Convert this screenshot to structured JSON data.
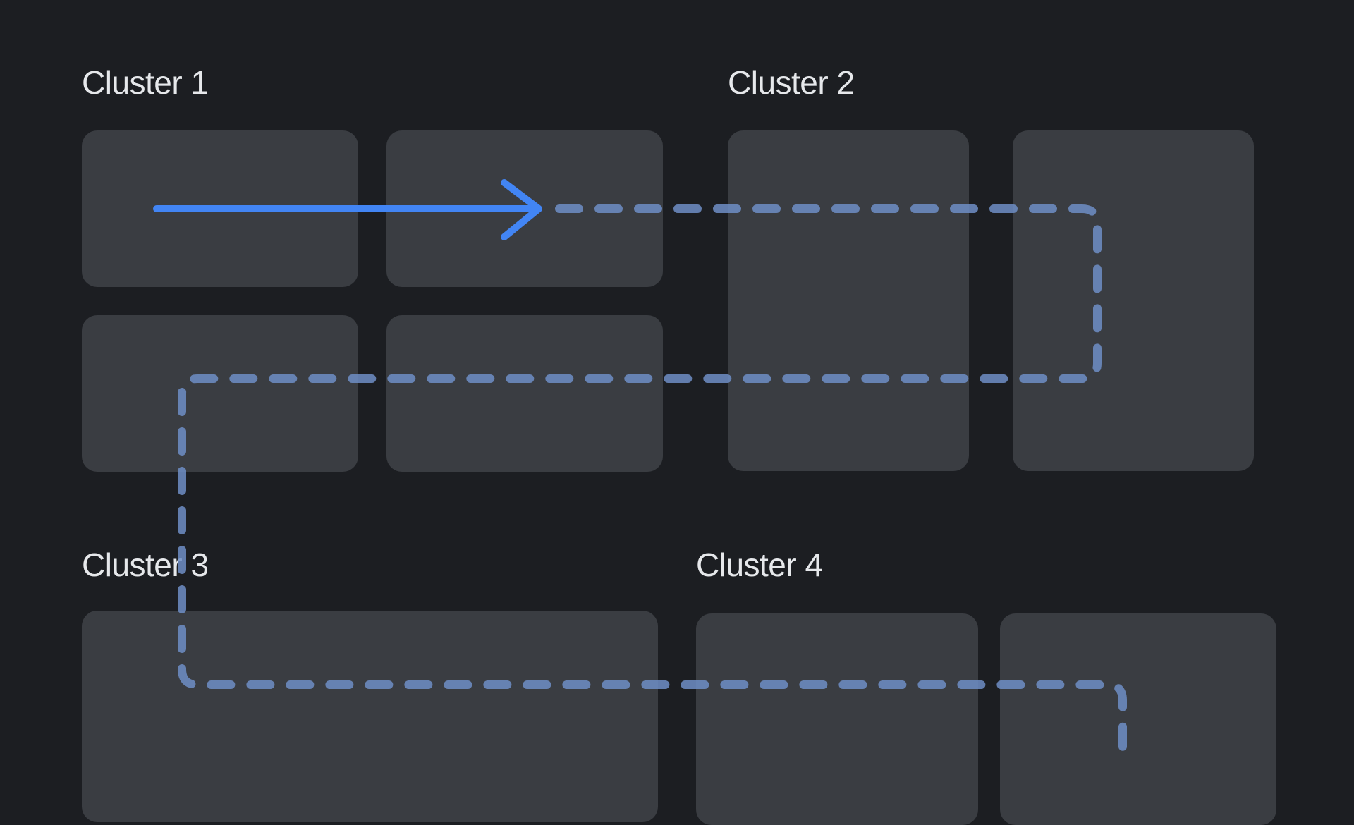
{
  "clusters": {
    "cluster1": {
      "label": "Cluster 1"
    },
    "cluster2": {
      "label": "Cluster 2"
    },
    "cluster3": {
      "label": "Cluster 3"
    },
    "cluster4": {
      "label": "Cluster 4"
    }
  },
  "colors": {
    "background": "#1c1e22",
    "node": "#3a3d42",
    "label": "#e6e8eb",
    "arrow_solid": "#4285f4",
    "arrow_dashed": "#6f8ec5"
  }
}
